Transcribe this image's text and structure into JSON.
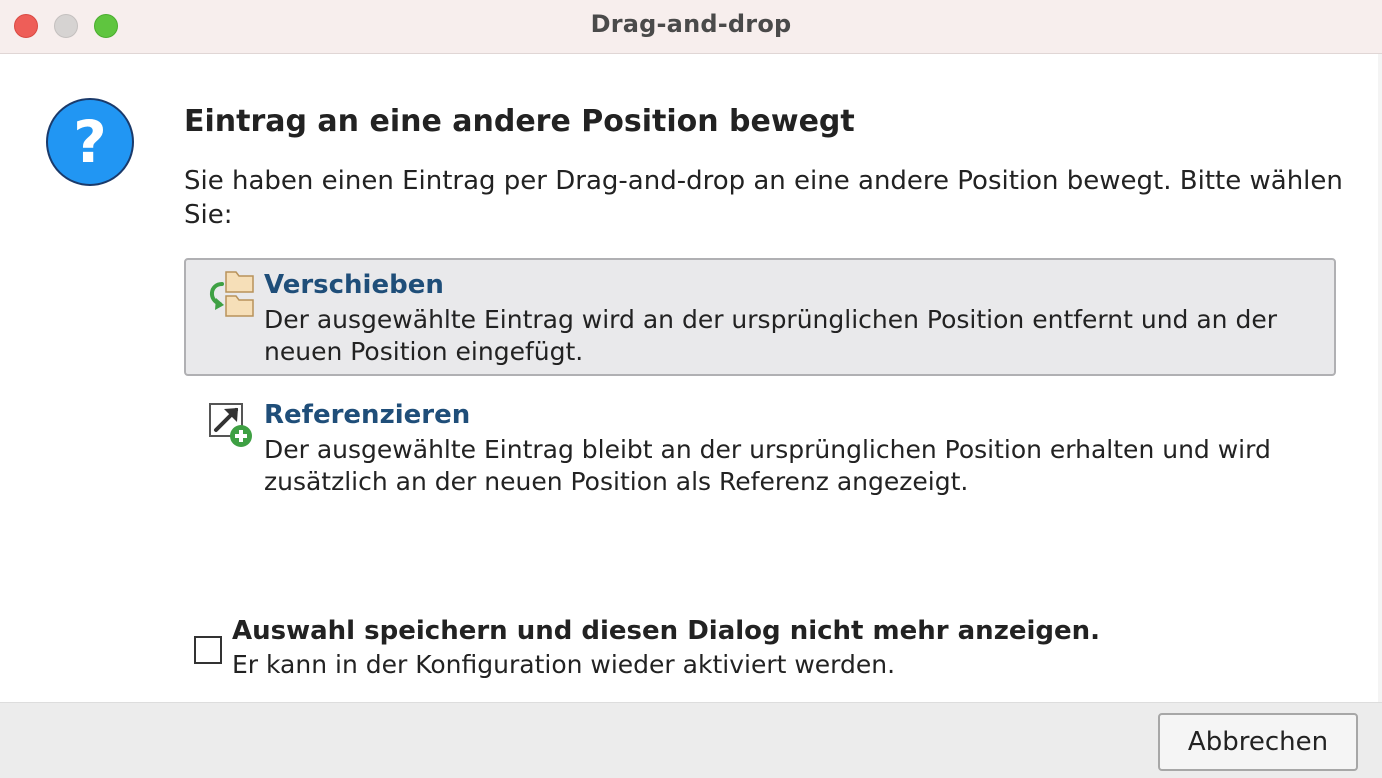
{
  "window": {
    "title": "Drag-and-drop"
  },
  "dialog": {
    "icon": "question-icon",
    "icon_glyph": "?",
    "heading": "Eintrag an eine andere Position bewegt",
    "description": "Sie haben einen Eintrag per Drag-and-drop an eine andere Position bewegt. Bitte wählen Sie:"
  },
  "options": [
    {
      "title": "Verschieben",
      "description": "Der ausgewählte Eintrag wird an der ursprünglichen Position entfernt und an der neuen Position eingefügt.",
      "icon": "move-folders-icon",
      "selected": true
    },
    {
      "title": "Referenzieren",
      "description": "Der ausgewählte Eintrag bleibt an der ursprünglichen Position erhalten und wird zusätzlich an der neuen Position als Referenz angezeigt.",
      "icon": "add-reference-icon",
      "selected": false
    }
  ],
  "remember": {
    "checked": false,
    "label": "Auswahl speichern und diesen Dialog nicht mehr anzeigen.",
    "sublabel": "Er kann in der Konfiguration wieder aktiviert werden."
  },
  "footer": {
    "cancel_label": "Abbrechen"
  },
  "colors": {
    "titlebar": "#f7eeed",
    "close": "#ee5e58",
    "minimize": "#d6d3d2",
    "zoom": "#5fc53f",
    "question_icon": "#2196f3",
    "option_title": "#1f4e79",
    "selected_option_bg": "#e9e9eb"
  }
}
